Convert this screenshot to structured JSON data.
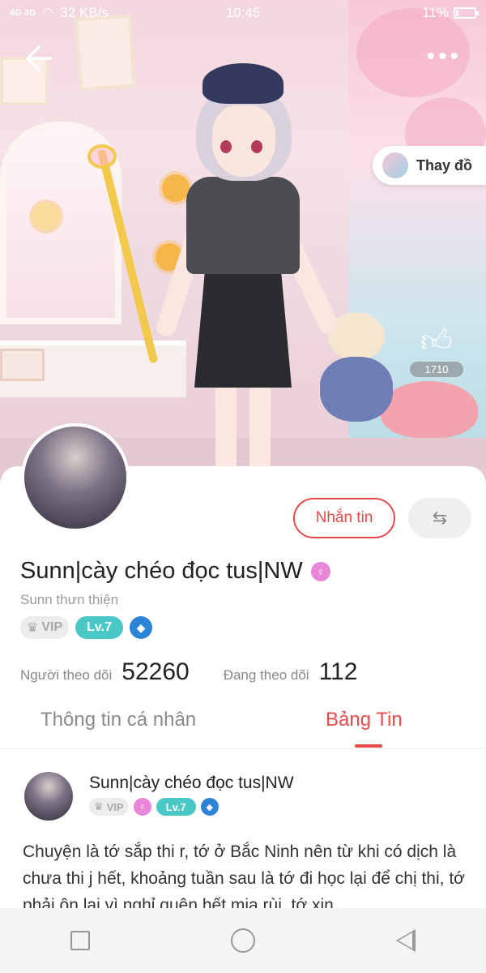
{
  "status_bar": {
    "signal": "4G 3G",
    "network_speed": "32 KB/s",
    "time": "10:45",
    "battery": "11%",
    "battery_level": 0.11
  },
  "hero": {
    "change_outfit_label": "Thay đồ",
    "like_count": "1710",
    "icons": {
      "back": "back-arrow-icon",
      "more": "more-dots-icon",
      "like": "thumbs-up-icon"
    }
  },
  "profile": {
    "message_button": "Nhắn tin",
    "switch_icon": "swap-arrows-icon",
    "name": "Sunn|cày chéo đọc tus|NW",
    "gender_icon": "female-icon",
    "subtitle": "Sunn thưn thiện",
    "badges": {
      "vip": "VIP",
      "level": "Lv.7",
      "extra_icon": "diamond-badge-icon"
    },
    "followers_label": "Người theo dõi",
    "followers_count": "52260",
    "following_label": "Đang theo dõi",
    "following_count": "112"
  },
  "tabs": [
    {
      "label": "Thông tin cá nhân",
      "active": false
    },
    {
      "label": "Bảng Tin",
      "active": true
    }
  ],
  "post": {
    "author": "Sunn|cày chéo đọc tus|NW",
    "badges": {
      "vip": "VIP",
      "level": "Lv.7"
    },
    "text": "Chuyện là tớ sắp thi r, tớ ở Bắc Ninh nên từ khi có dịch là chưa thi j hết, khoảng tuần sau là tớ đi học lại để chị thi, tớ phải ôn lại vì nghỉ quên hết mịa rùi, tớ xin"
  },
  "colors": {
    "accent": "#e84949",
    "level": "#4ac7c7",
    "vip": "#a8a8a8",
    "gender": "#e986d7"
  },
  "nav_bar": {
    "icons": [
      "recent-apps-icon",
      "home-icon",
      "back-icon"
    ]
  }
}
